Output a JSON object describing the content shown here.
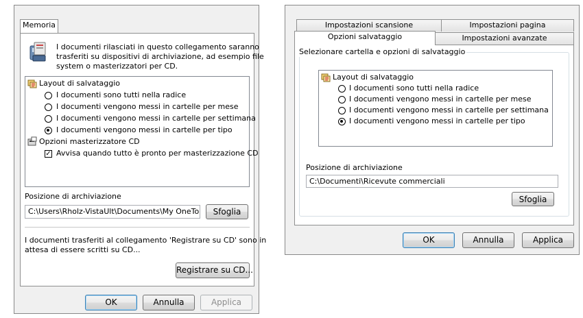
{
  "left": {
    "tab": "Memoria",
    "info_text": [
      "I documenti rilasciati in questo collegamento saranno",
      "trasferiti su dispositivi di archiviazione, ad esempio file",
      "system o masterizzatori per CD."
    ],
    "tree": {
      "layout_header": "Layout di salvataggio",
      "options": [
        "I documenti sono tutti nella radice",
        "I documenti vengono messi in cartelle per mese",
        "I documenti vengono messi in cartelle per settimana",
        "I documenti vengono messi in cartelle per tipo"
      ],
      "selected_index": 3,
      "burner_header": "Opzioni masterizzatore CD",
      "burner_option": "Avvisa quando tutto è pronto per masterizzazione CD",
      "burner_checked": true
    },
    "location_label": "Posizione di archiviazione",
    "location_value": "C:\\Users\\Rholz-VistaUlt\\Documents\\My OneTouc",
    "browse_button": "Sfoglia",
    "pending_text": [
      "I documenti trasferiti al collegamento 'Registrare su CD' sono in",
      "attesa di essere scritti su CD..."
    ],
    "burn_button": "Registrare su CD...",
    "ok": "OK",
    "cancel": "Annulla",
    "apply": "Applica"
  },
  "right": {
    "tabs_back": [
      "Impostazioni scansione",
      "Impostazioni pagina"
    ],
    "tabs_front": [
      "Opzioni salvataggio",
      "Impostazioni avanzate"
    ],
    "group_label": "Selezionare cartella e opzioni di salvataggio",
    "tree": {
      "layout_header": "Layout di salvataggio",
      "options": [
        "I documenti sono tutti nella radice",
        "I documenti vengono messi in cartelle per mese",
        "I documenti vengono messi in cartelle per settimana",
        "I documenti vengono messi in cartelle per tipo"
      ],
      "selected_index": 3
    },
    "location_label": "Posizione di archiviazione",
    "location_value": "C:\\Documenti\\Ricevute commerciali",
    "browse_button": "Sfoglia",
    "ok": "OK",
    "cancel": "Annulla",
    "apply": "Applica"
  }
}
